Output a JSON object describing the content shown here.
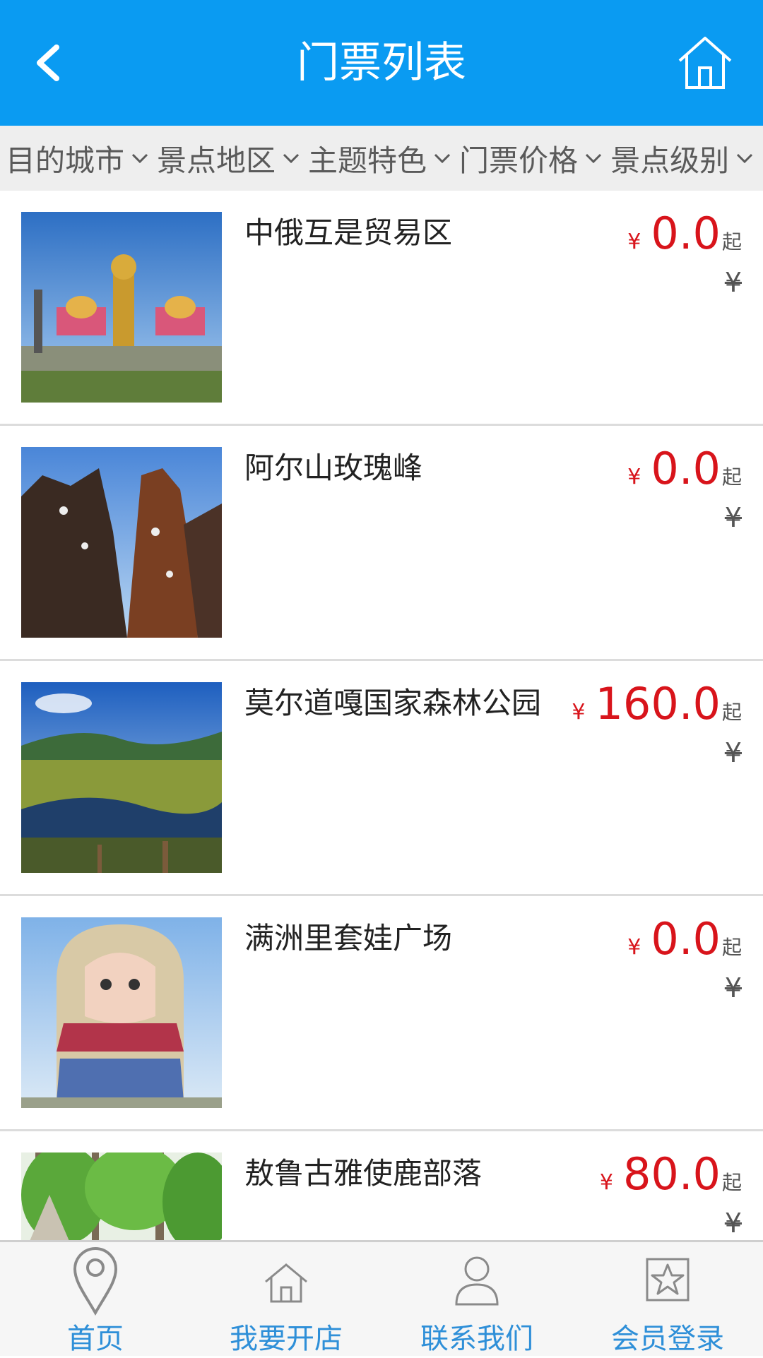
{
  "header": {
    "title": "门票列表",
    "back_icon": "chevron-left-icon",
    "home_icon": "home-icon",
    "background": "#0a9bf2"
  },
  "filters": [
    {
      "label": "目的城市"
    },
    {
      "label": "景点地区"
    },
    {
      "label": "主题特色"
    },
    {
      "label": "门票价格"
    },
    {
      "label": "景点级别"
    }
  ],
  "list": {
    "currency": "¥",
    "suffix": "起",
    "items": [
      {
        "name": "中俄互是贸易区",
        "price": "0.0",
        "original": "¥"
      },
      {
        "name": "阿尔山玫瑰峰",
        "price": "0.0",
        "original": "¥"
      },
      {
        "name": "莫尔道嘎国家森林公园",
        "price": "160.0",
        "original": "¥"
      },
      {
        "name": "满洲里套娃广场",
        "price": "0.0",
        "original": "¥"
      },
      {
        "name": "敖鲁古雅使鹿部落",
        "price": "80.0",
        "original": "¥"
      }
    ]
  },
  "tabbar": {
    "accent": "#2e8fd8",
    "items": [
      {
        "label": "首页",
        "icon": "map-pin-icon"
      },
      {
        "label": "我要开店",
        "icon": "home-outline-icon"
      },
      {
        "label": "联系我们",
        "icon": "user-icon"
      },
      {
        "label": "会员登录",
        "icon": "star-icon"
      }
    ]
  }
}
